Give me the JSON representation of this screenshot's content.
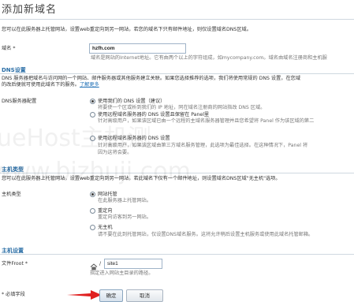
{
  "page": {
    "title": "添加新域名"
  },
  "intro": "您可以在此服务器上托管网站，设置web重定向到另一网站，若您的域名下只有邮件地址，则仅设置域名DNS区域。",
  "domain": {
    "label": "域名 *",
    "value": "hzfh.com",
    "hint": "域名是网站的Internet地址。它有由两个以上的字符组成，如mycompany.com。域名由域名注册商和主机服"
  },
  "dns": {
    "section_title": "DNS设置",
    "desc_line1": "DNS 服务器把域名与访问网的一个网站、邮件服务器或其他服务建立关联。如果您选择推荐的选项，我们将使用常规的 DNS 设置，在您域",
    "desc_line2": "的改后便就可使用此域名下的服务。",
    "more_link": "了解更多",
    "label": "DNS服务器配置",
    "options": [
      {
        "label": "使用我们的 DNS 设置（建议）",
        "hint1": "将要使一个区或析到我们的 IP 地址，同在域名注册商的网站指改 DNS 区域。",
        "hint2": "",
        "selected": true
      },
      {
        "label": "使用远程域名服务器的 DNS 设置且保留在 Panel里",
        "hint1": "针对高级用户，如果该区域已由一个远程的主域名服务器管理并且您希望将 Panel 作为该区域的第二",
        "hint2": "",
        "selected": false
      },
      {
        "label": "使用远程域名服务器的 DNS 设置",
        "hint1": "针对高级用户，如果该区域由第三方域名服务管理，此选项为最佳选择。在这种情况下，Panel 将",
        "hint2": "因为这将会要。",
        "selected": false
      }
    ]
  },
  "hosting": {
    "section_title": "主机类型",
    "desc": "您可以在此服务器上托管网站，设置web重定向到另一网站，若此域名下仅有一个邮件地址，则设置域名DNS区域\"无主机\"选项。",
    "label": "主机类型",
    "options": [
      {
        "label": "网站托管",
        "hint": "在此服务器上托管网站。",
        "selected": true
      },
      {
        "label": "重定向",
        "hint": "重定向访客到另一网站。",
        "selected": false
      },
      {
        "label": "无主机",
        "hint": "请不要在此到托管网站，仅设置DNS域名服务。这将允许稍后设置主机服务或使用此域名托管邮箱。",
        "selected": false
      }
    ]
  },
  "host_settings": {
    "section_title": "主机设置",
    "docroot_label": "文件Froot *",
    "docroot_prefix": "/",
    "docroot_value": "site1",
    "docroot_hint": "指定进入网站主目录的路径。"
  },
  "footer": {
    "required_note": "* 必填字段",
    "ok_label": "确定",
    "cancel_label": "取消"
  },
  "watermark": {
    "line1": "ueHost主机测",
    "line2": "www.bizhuji.com"
  }
}
